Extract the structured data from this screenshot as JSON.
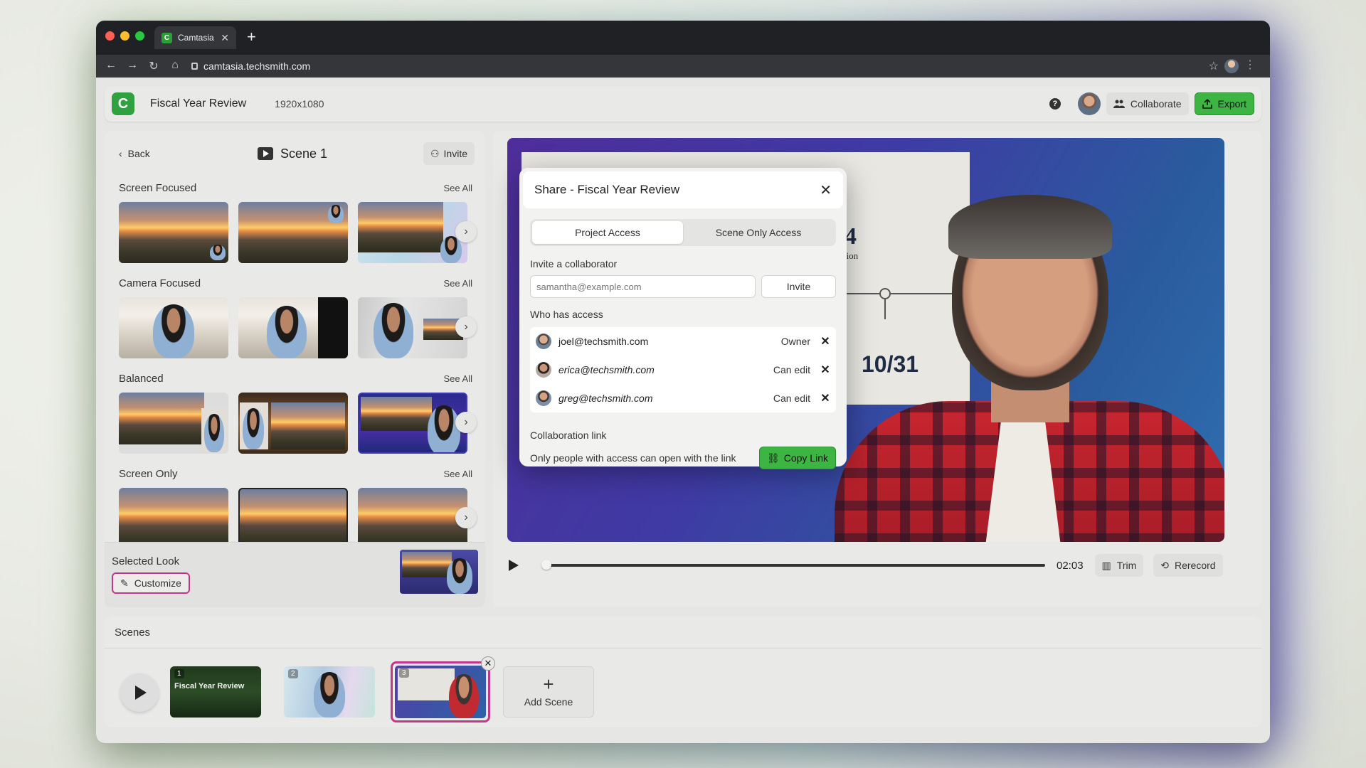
{
  "browser": {
    "tab_title": "Camtasia",
    "tab_favicon": "C",
    "url": "camtasia.techsmith.com"
  },
  "app": {
    "logo": "C",
    "project_title": "Fiscal Year Review",
    "resolution": "1920x1080",
    "collaborate_label": "Collaborate",
    "export_label": "Export",
    "help": "?"
  },
  "left_panel": {
    "back_label": "Back",
    "scene_title": "Scene 1",
    "invite_label": "Invite",
    "sections": [
      {
        "title": "Screen Focused",
        "see_all": "See All"
      },
      {
        "title": "Camera Focused",
        "see_all": "See All"
      },
      {
        "title": "Balanced",
        "see_all": "See All"
      },
      {
        "title": "Screen Only",
        "see_all": "See All"
      }
    ],
    "selected_look_label": "Selected Look",
    "customize_label": "Customize"
  },
  "preview": {
    "slide_big": "24",
    "slide_sub": "luction",
    "slide_date": "10/31",
    "time": "02:03",
    "trim_label": "Trim",
    "rerecord_label": "Rerecord",
    "progress": 0.0
  },
  "scenes": {
    "title": "Scenes",
    "items": [
      {
        "num": "1",
        "text": "Fiscal Year Review"
      },
      {
        "num": "2",
        "text": ""
      },
      {
        "num": "3",
        "text": ""
      }
    ],
    "add_label": "Add Scene"
  },
  "modal": {
    "title": "Share - Fiscal Year Review",
    "tabs": [
      "Project Access",
      "Scene Only Access"
    ],
    "invite_label": "Invite a collaborator",
    "email_placeholder": "samantha@example.com",
    "invite_button": "Invite",
    "who_label": "Who has access",
    "access": [
      {
        "email": "joel@techsmith.com",
        "role": "Owner"
      },
      {
        "email": "erica@techsmith.com",
        "role": "Can edit"
      },
      {
        "email": "greg@techsmith.com",
        "role": "Can edit"
      }
    ],
    "link_label": "Collaboration link",
    "link_desc": "Only people with access can open with the link",
    "copy_label": "Copy Link"
  },
  "colors": {
    "accent_green": "#3db542",
    "selection_magenta": "#c2378a"
  }
}
